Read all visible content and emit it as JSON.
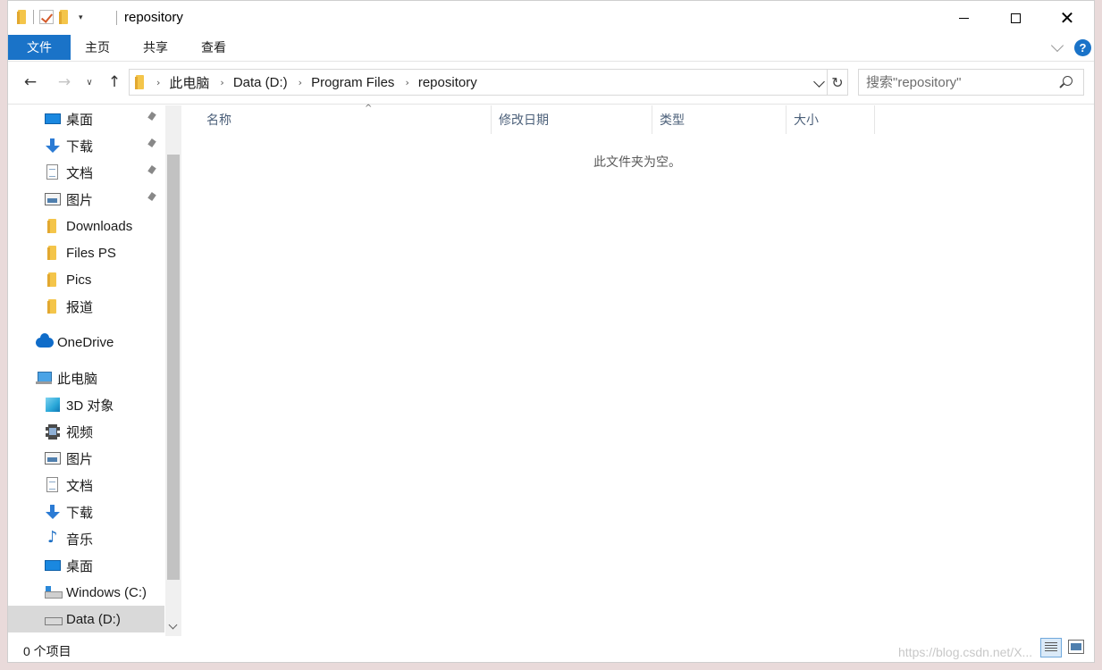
{
  "window": {
    "title": "repository",
    "quick_access_icons": [
      "folder-icon",
      "properties-check-icon",
      "new-folder-icon",
      "customize-caret-icon"
    ],
    "controls": {
      "minimize": "minimize-icon",
      "maximize": "maximize-icon",
      "close": "close-icon"
    }
  },
  "ribbon": {
    "tabs": [
      {
        "label": "文件",
        "active": true
      },
      {
        "label": "主页"
      },
      {
        "label": "共享"
      },
      {
        "label": "查看"
      }
    ],
    "accent_color": "#1a73c8",
    "help_label": "?"
  },
  "address_bar": {
    "breadcrumb": [
      "此电脑",
      "Data (D:)",
      "Program Files",
      "repository"
    ]
  },
  "search": {
    "placeholder": "搜索\"repository\""
  },
  "nav_pane": {
    "quick_access": [
      {
        "label": "桌面",
        "icon": "desktop-icon",
        "pinned": true
      },
      {
        "label": "下载",
        "icon": "download-icon",
        "pinned": true
      },
      {
        "label": "文档",
        "icon": "document-icon",
        "pinned": true
      },
      {
        "label": "图片",
        "icon": "picture-icon",
        "pinned": true
      },
      {
        "label": "Downloads",
        "icon": "folder-icon"
      },
      {
        "label": "Files PS",
        "icon": "folder-icon"
      },
      {
        "label": "Pics",
        "icon": "folder-icon"
      },
      {
        "label": "报道",
        "icon": "folder-icon"
      }
    ],
    "onedrive": {
      "label": "OneDrive",
      "icon": "cloud-icon"
    },
    "this_pc": {
      "label": "此电脑",
      "icon": "computer-icon"
    },
    "this_pc_items": [
      {
        "label": "3D 对象",
        "icon": "3d-objects-icon"
      },
      {
        "label": "视频",
        "icon": "video-icon"
      },
      {
        "label": "图片",
        "icon": "picture-icon"
      },
      {
        "label": "文档",
        "icon": "document-icon"
      },
      {
        "label": "下载",
        "icon": "download-icon"
      },
      {
        "label": "音乐",
        "icon": "music-icon"
      },
      {
        "label": "桌面",
        "icon": "desktop-icon"
      },
      {
        "label": "Windows (C:)",
        "icon": "windows-drive-icon"
      },
      {
        "label": "Data (D:)",
        "icon": "drive-icon",
        "selected": true
      }
    ]
  },
  "content": {
    "columns": [
      "名称",
      "修改日期",
      "类型",
      "大小"
    ],
    "sort_column": "名称",
    "empty_message": "此文件夹为空。"
  },
  "status_bar": {
    "item_count": "0 个项目",
    "watermark": "https://blog.csdn.net/X..."
  }
}
